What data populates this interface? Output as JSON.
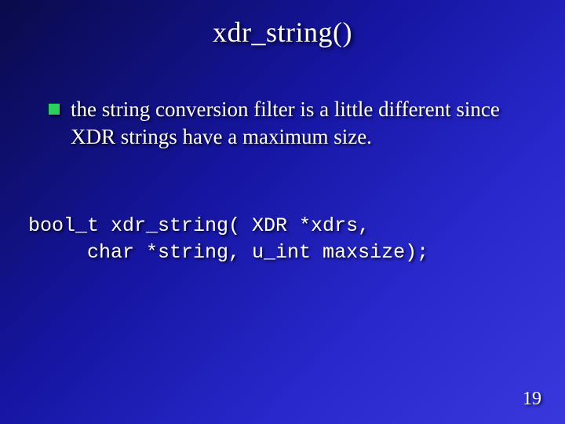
{
  "title": "xdr_string()",
  "bullet": {
    "text": "the string conversion filter is a little different since XDR strings have a maximum size."
  },
  "code": {
    "line1": "bool_t xdr_string( XDR *xdrs,",
    "line2": "     char *string, u_int maxsize);"
  },
  "page_number": "19"
}
